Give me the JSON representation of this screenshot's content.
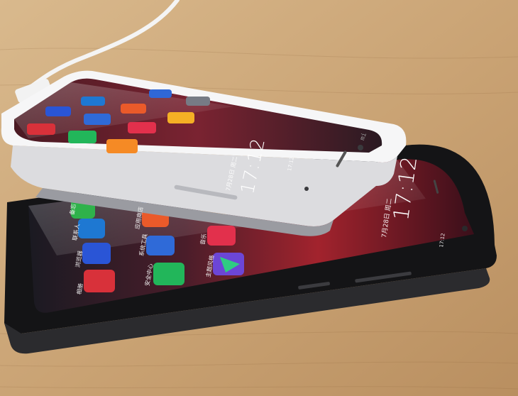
{
  "image": {
    "subject": "two-smartphones-on-table",
    "colors": {
      "table": "#c9a67a",
      "white_phone_frame": "#f2f2f4",
      "black_phone_frame": "#1c1c1e",
      "accent_red": "#d8313a"
    }
  },
  "black_phone": {
    "time": "17:12",
    "date": "7月28日 周二",
    "status_time": "17:12",
    "app_labels": [
      "备忘",
      "联系人",
      "浏览器",
      "相册",
      "应用商店",
      "系统工具",
      "安全中心",
      "音乐",
      "主题风格"
    ]
  },
  "white_phone": {
    "time": "17:12",
    "date": "7月28日 周二",
    "status_time": "17:12",
    "logo": "mi"
  }
}
